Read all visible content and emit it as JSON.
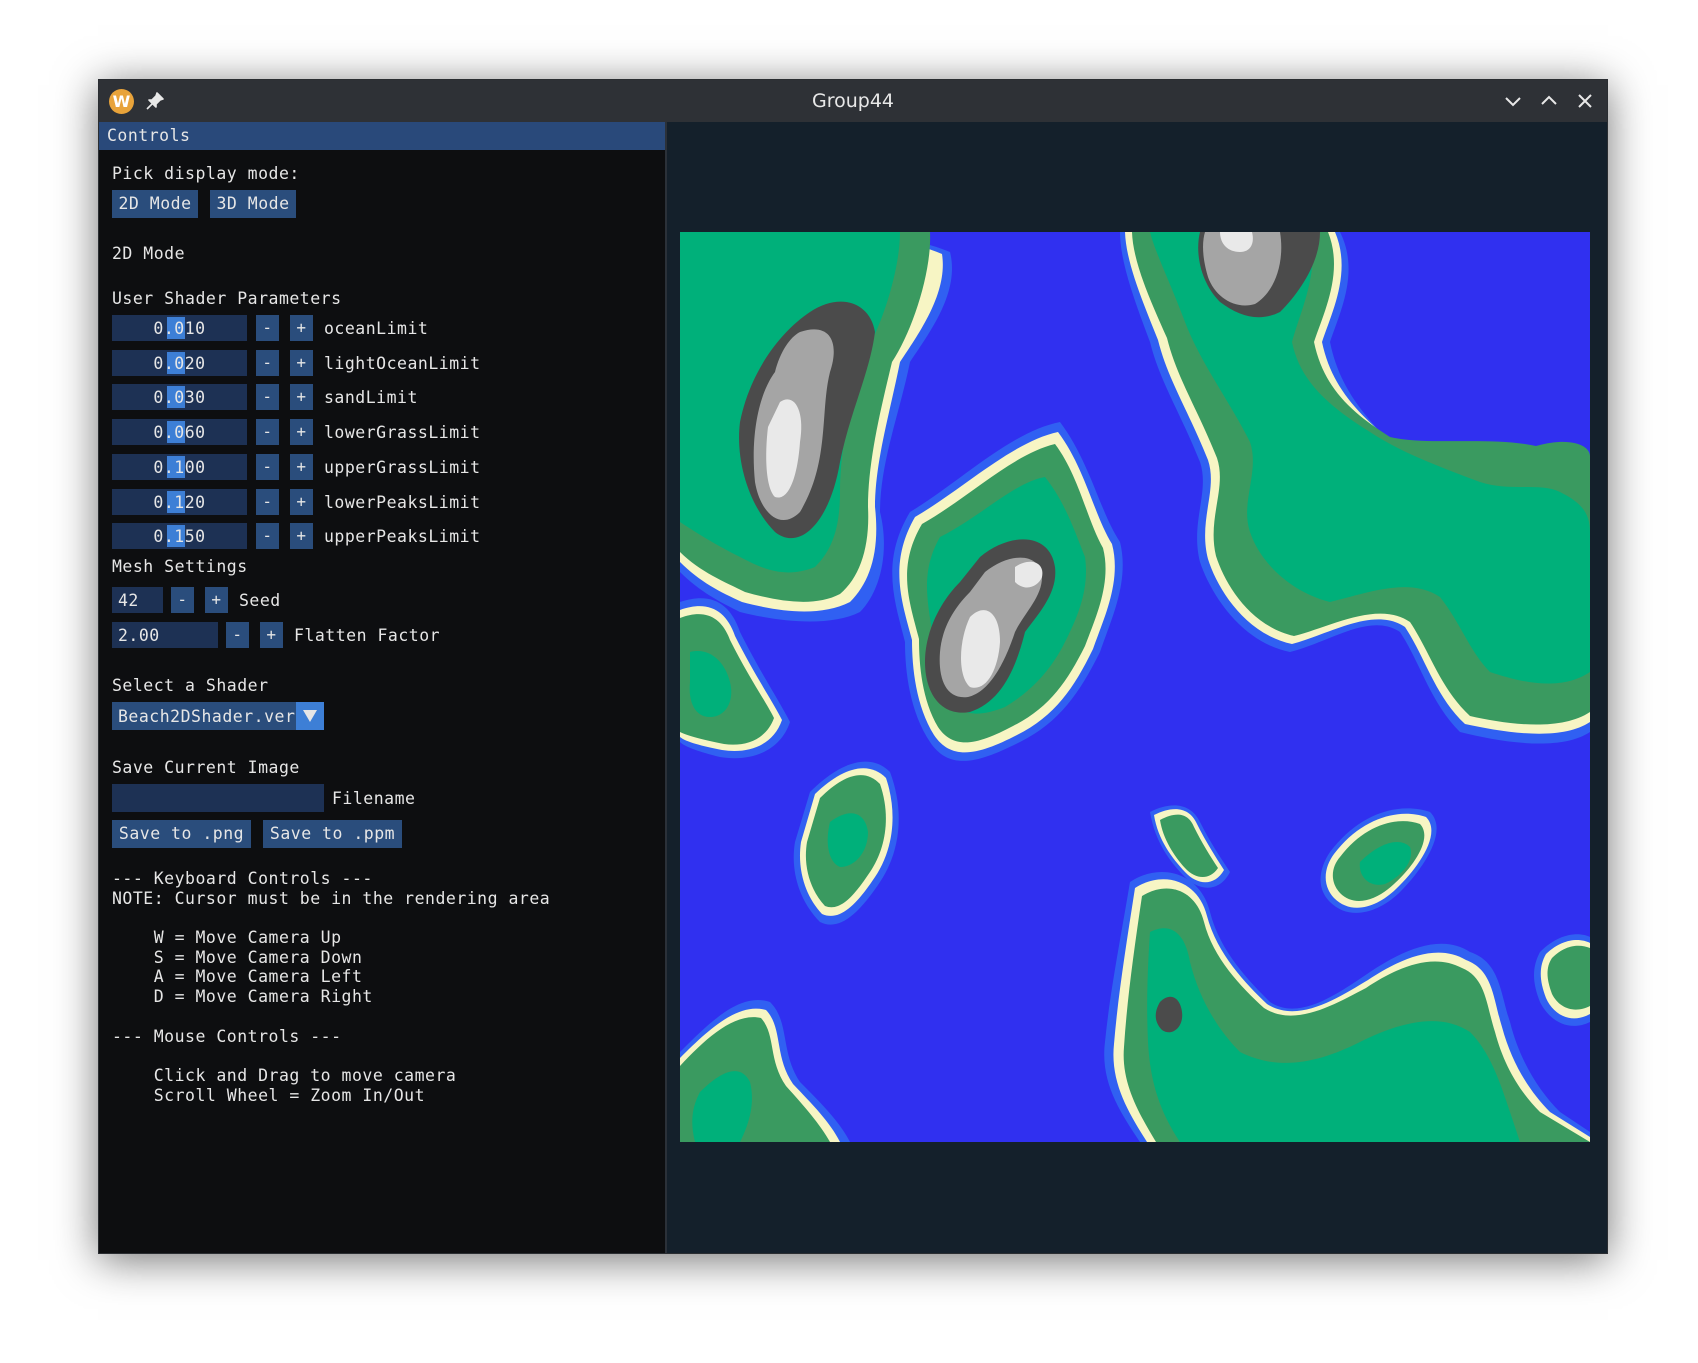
{
  "window": {
    "title": "Group44",
    "app_icon_letter": "W"
  },
  "controls": {
    "header": "Controls",
    "pick_mode_label": "Pick display mode:",
    "mode_buttons": [
      "2D Mode",
      "3D Mode"
    ],
    "current_mode": "2D Mode",
    "shader_params_heading": "User Shader Parameters",
    "params": [
      {
        "value": "0.010",
        "name": "oceanLimit"
      },
      {
        "value": "0.020",
        "name": "lightOceanLimit"
      },
      {
        "value": "0.030",
        "name": "sandLimit"
      },
      {
        "value": "0.060",
        "name": "lowerGrassLimit"
      },
      {
        "value": "0.100",
        "name": "upperGrassLimit"
      },
      {
        "value": "0.120",
        "name": "lowerPeaksLimit"
      },
      {
        "value": "0.150",
        "name": "upperPeaksLimit"
      }
    ],
    "step_minus": "-",
    "step_plus": "+",
    "mesh_heading": "Mesh Settings",
    "seed": {
      "value": "42",
      "label": "Seed"
    },
    "flatten": {
      "value": "2.00",
      "label": "Flatten Factor"
    },
    "shader_select_heading": "Select a Shader",
    "shader_selected": "Beach2DShader.ver",
    "save_heading": "Save Current Image",
    "filename_value": "",
    "filename_label": "Filename",
    "save_buttons": [
      "Save to .png",
      "Save to .ppm"
    ],
    "help_lines": [
      "--- Keyboard Controls ---",
      "NOTE: Cursor must be in the rendering area",
      "",
      "    W = Move Camera Up",
      "    S = Move Camera Down",
      "    A = Move Camera Left",
      "    D = Move Camera Right",
      "",
      "--- Mouse Controls ---",
      "",
      "    Click and Drag to move camera",
      "    Scroll Wheel = Zoom In/Out"
    ]
  },
  "terrain_colors": {
    "ocean": "#3030f0",
    "light_ocean": "#2d6cf2",
    "sand": "#f7f5c4",
    "lower_grass": "#3a9a60",
    "upper_grass": "#00b07a",
    "lower_peaks": "#4b4b4b",
    "upper_peaks": "#a5a5a5",
    "snow": "#e9e9e9"
  }
}
